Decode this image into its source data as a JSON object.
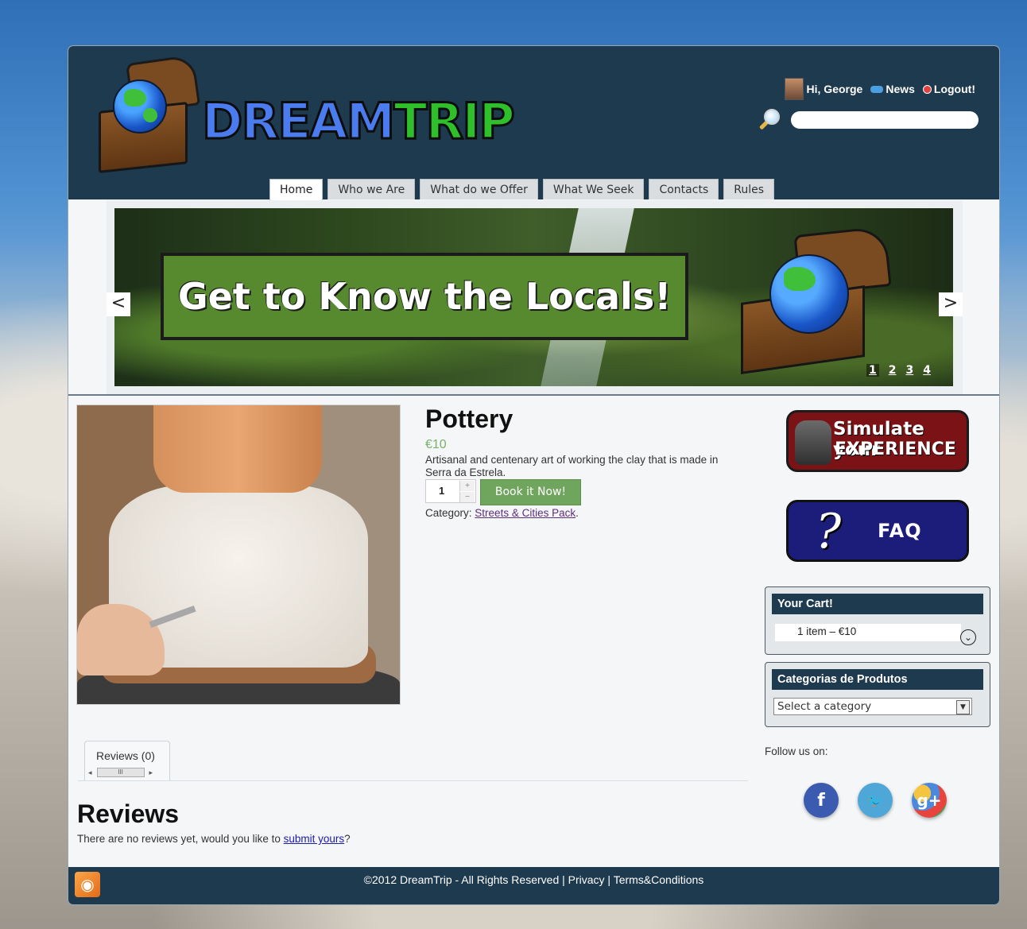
{
  "header": {
    "logo": {
      "part1": "DREAM",
      "part2": "TRIP"
    },
    "user": {
      "greeting": "Hi, George",
      "news": "News",
      "logout": "Logout!"
    },
    "search": {
      "placeholder": ""
    },
    "nav": [
      {
        "label": "Home",
        "active": true
      },
      {
        "label": "Who we Are",
        "active": false
      },
      {
        "label": "What do we Offer",
        "active": false
      },
      {
        "label": "What We Seek",
        "active": false
      },
      {
        "label": "Contacts",
        "active": false
      },
      {
        "label": "Rules",
        "active": false
      }
    ]
  },
  "slider": {
    "banner": "Get to Know the Locals!",
    "prev": "<",
    "next": ">",
    "pages": [
      "1",
      "2",
      "3",
      "4"
    ],
    "current_page": "1"
  },
  "product": {
    "title": "Pottery",
    "price": "€10",
    "description": "Artisanal and centenary art of working the clay that is made in Serra da Estrela.",
    "quantity": "1",
    "book_label": "Book it Now!",
    "category_label": "Category:",
    "category_link": "Streets & Cities Pack",
    "category_end": "."
  },
  "reviews": {
    "tab_label": "Reviews (0)",
    "heading": "Reviews",
    "note_prefix": "There are no reviews yet, would you like to",
    "note_link": "submit yours",
    "note_suffix": "?"
  },
  "sidebar": {
    "simulate_line1": "Simulate your",
    "simulate_line2": "EXPERIENCE",
    "faq": "FAQ",
    "cart": {
      "title": "Your Cart!",
      "summary": "1 item – €10"
    },
    "categories": {
      "title": "Categorias de Produtos",
      "selected": "Select a category"
    },
    "follow": "Follow us on:",
    "social": [
      "f",
      "🐦",
      "g+"
    ]
  },
  "footer": {
    "copyright": "©2012 DreamTrip - All Rights Reserved | Privacy | Terms&Conditions"
  },
  "colors": {
    "header_bg": "#1e3a4f",
    "accent_green": "#6fa55d",
    "price_green": "#7bb26a",
    "link_purple": "#5b2f7a"
  }
}
